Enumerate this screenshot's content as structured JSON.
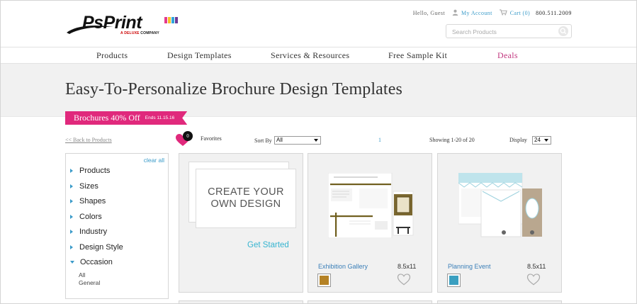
{
  "brand": {
    "name": "PsPrint",
    "tagline_deluxe": "A DELUXE",
    "tagline_company": " COMPANY",
    "colors": [
      "#e43b8b",
      "#f7c326",
      "#2fa6dc",
      "#6c3c98"
    ]
  },
  "util": {
    "greeting": "Hello, Guest",
    "my_account": "My Account",
    "cart": "Cart (0)",
    "phone": "800.511.2009"
  },
  "search": {
    "placeholder": "Search Products",
    "icon": "search-icon"
  },
  "nav": {
    "products": "Products",
    "design_templates": "Design Templates",
    "services": "Services & Resources",
    "free_sample": "Free Sample Kit",
    "deals": "Deals"
  },
  "hero": {
    "title": "Easy-To-Personalize Brochure Design Templates"
  },
  "promo": {
    "label": "Brochures 40% Off",
    "ends": "Ends 11.15.16"
  },
  "toolbar": {
    "back": "<< Back to Products",
    "favorites_count": "0",
    "favorites_label": "Favorites",
    "sort_label": "Sort By",
    "sort_value": "All",
    "page": "1",
    "showing": "Showing 1-20 of 20",
    "display_label": "Display",
    "display_value": "24"
  },
  "sidebar": {
    "clear_all": "clear all",
    "filters": [
      {
        "label": "Products"
      },
      {
        "label": "Sizes"
      },
      {
        "label": "Shapes"
      },
      {
        "label": "Colors"
      },
      {
        "label": "Industry"
      },
      {
        "label": "Design Style"
      },
      {
        "label": "Occasion",
        "expanded": true
      }
    ],
    "occasion_values": [
      "All",
      "General"
    ]
  },
  "create_card": {
    "line1": "CREATE YOUR",
    "line2": "OWN DESIGN",
    "cta": "Get Started"
  },
  "templates": [
    {
      "name": "Exhibition Gallery",
      "size": "8.5x11",
      "swatch": "#b58225"
    },
    {
      "name": "Planning Event",
      "size": "8.5x11",
      "swatch": "#3a9fc0"
    }
  ]
}
